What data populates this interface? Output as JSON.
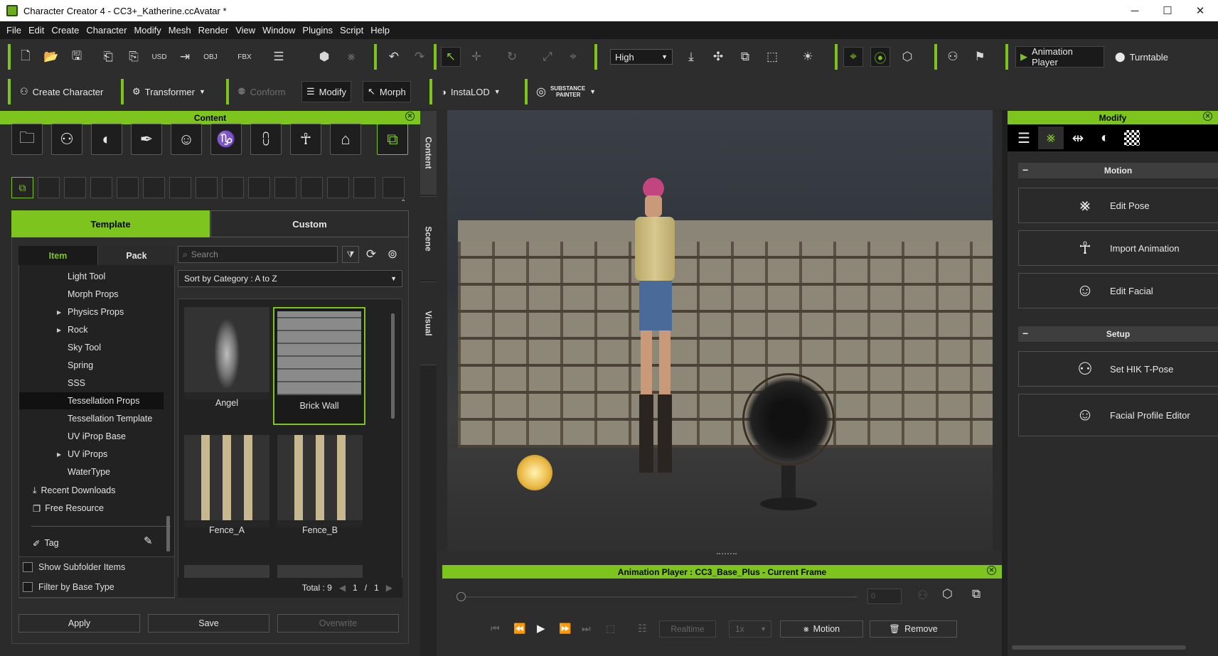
{
  "window": {
    "title": "Character Creator 4 - CC3+_Katherine.ccAvatar *"
  },
  "menu": [
    "File",
    "Edit",
    "Create",
    "Character",
    "Modify",
    "Mesh",
    "Render",
    "View",
    "Window",
    "Plugins",
    "Script",
    "Help"
  ],
  "toolbar1": {
    "quality_select": "High",
    "animation_player": "Animation Player",
    "turntable": "Turntable",
    "icons": [
      "new-icon",
      "open-icon",
      "save-icon",
      "export-icon",
      "import-icon",
      "usd-icon",
      "export-arrow-icon",
      "obj-icon",
      "fbx-icon",
      "layers-icon",
      "avatar-icon",
      "pose-icon",
      "undo-icon",
      "redo-icon",
      "select-icon",
      "move-icon",
      "rotate-icon",
      "scale-icon",
      "pivot-icon",
      "camera-down-icon",
      "camera-fit-icon",
      "camera-frame-icon",
      "camera-zoom-icon",
      "light-icon",
      "gizmo-icon",
      "gizmo-alt-icon",
      "cubes-icon",
      "figure-icon",
      "flag-icon"
    ]
  },
  "toolbar2": {
    "create_character": "Create Character",
    "transformer": "Transformer",
    "conform": "Conform",
    "modify": "Modify",
    "morph": "Morph",
    "instalod": "InstaLOD",
    "substance_top": "SUBSTANCE",
    "substance_bottom": "PAINTER"
  },
  "content": {
    "title": "Content",
    "tabs": {
      "template": "Template",
      "custom": "Custom"
    },
    "subtabs": {
      "item": "Item",
      "pack": "Pack"
    },
    "search_placeholder": "Search",
    "sort": "Sort by Category : A to Z",
    "tree": [
      {
        "label": "Light Tool",
        "arrow": false
      },
      {
        "label": "Morph Props",
        "arrow": false
      },
      {
        "label": "Physics Props",
        "arrow": true
      },
      {
        "label": "Rock",
        "arrow": true
      },
      {
        "label": "Sky Tool",
        "arrow": false
      },
      {
        "label": "Spring",
        "arrow": false
      },
      {
        "label": "SSS",
        "arrow": false
      },
      {
        "label": "Tessellation Props",
        "arrow": false,
        "selected": true
      },
      {
        "label": "Tessellation Template",
        "arrow": false
      },
      {
        "label": "UV iProp Base",
        "arrow": false
      },
      {
        "label": "UV iProps",
        "arrow": true
      },
      {
        "label": "WaterType",
        "arrow": false
      }
    ],
    "recent_downloads": "Recent Downloads",
    "free_resource": "Free Resource",
    "tag": "Tag",
    "show_subfolder": "Show Subfolder Items",
    "filter_base": "Filter by Base Type",
    "thumbnails": [
      "Angel",
      "Brick Wall",
      "Fence_A",
      "Fence_B"
    ],
    "total": "Total : 9",
    "page": "1",
    "pages": "1",
    "page_sep": "/",
    "buttons": {
      "apply": "Apply",
      "save": "Save",
      "overwrite": "Overwrite"
    }
  },
  "side_tabs": [
    "Content",
    "Scene",
    "Visual"
  ],
  "anim_player": {
    "title": "Animation Player : CC3_Base_Plus - Current Frame",
    "frame": "0",
    "realtime": "Realtime",
    "speed": "1x",
    "motion": "Motion",
    "remove": "Remove"
  },
  "modify": {
    "title": "Modify",
    "motion_section": "Motion",
    "setup_section": "Setup",
    "motion_buttons": [
      "Edit Pose",
      "Import Animation",
      "Edit Facial"
    ],
    "setup_buttons": [
      "Set HIK T-Pose",
      "Facial Profile Editor"
    ]
  },
  "colors": {
    "accent": "#7ec41e",
    "panel": "#2b2b2b",
    "dark": "#1a1a1a"
  }
}
